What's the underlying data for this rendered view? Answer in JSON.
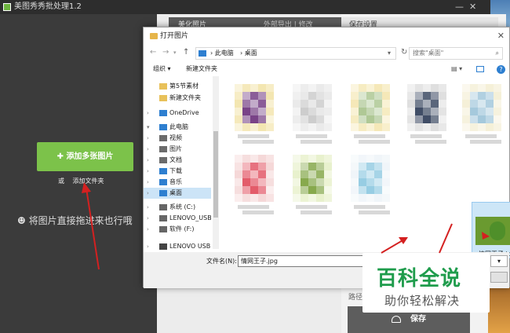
{
  "app": {
    "title": "美图秀秀批处理1.2",
    "add_button": "添加多张图片",
    "add_folder_prefix": "或",
    "add_folder_link": "添加文件夹",
    "drag_hint": "将图片直接拖进来也行哦",
    "mid_tab": "美化照片",
    "mid_tab_extra": "外部导出 | 修改",
    "right_header": "保存设置",
    "path_label": "路径",
    "save_button": "保存"
  },
  "dialog": {
    "title": "打开图片",
    "breadcrumb": [
      "此电脑",
      "桌面"
    ],
    "search_placeholder": "搜索\"桌面\"",
    "organize": "组织 ▾",
    "new_folder": "新建文件夹",
    "help": "?",
    "nav_items": [
      {
        "label": "第5节素材",
        "icon": "folder-icon",
        "color": "#e8c15a"
      },
      {
        "label": "新建文件夹",
        "icon": "folder-icon",
        "color": "#e8c15a"
      },
      {
        "label": "OneDrive",
        "icon": "cloud-icon",
        "color": "#2e7fd0"
      },
      {
        "label": "此电脑",
        "icon": "computer-icon",
        "color": "#2e7fd0"
      },
      {
        "label": "视频",
        "icon": "video-icon",
        "color": "#6b6b6b"
      },
      {
        "label": "图片",
        "icon": "picture-icon",
        "color": "#6b6b6b"
      },
      {
        "label": "文档",
        "icon": "document-icon",
        "color": "#6b6b6b"
      },
      {
        "label": "下载",
        "icon": "download-icon",
        "color": "#2e7fd0"
      },
      {
        "label": "音乐",
        "icon": "music-icon",
        "color": "#2e7fd0"
      },
      {
        "label": "桌面",
        "icon": "desktop-icon",
        "color": "#2e7fd0"
      },
      {
        "label": "系统 (C:)",
        "icon": "drive-icon",
        "color": "#666"
      },
      {
        "label": "LENOVO_USB_",
        "icon": "drive-icon",
        "color": "#666"
      },
      {
        "label": "软件 (F:)",
        "icon": "drive-icon",
        "color": "#666"
      },
      {
        "label": "LENOVO USB H",
        "icon": "drive-icon",
        "color": "#444"
      }
    ],
    "selected_file_name": "情网王子.jpg",
    "filename_label": "文件名(N):",
    "filename_value": "情网王子.jpg"
  },
  "watermark": {
    "big": "百科全说",
    "small": "助你轻松解决"
  },
  "colors": {
    "accent_green": "#7cc24a",
    "arrow_red": "#d42020"
  }
}
